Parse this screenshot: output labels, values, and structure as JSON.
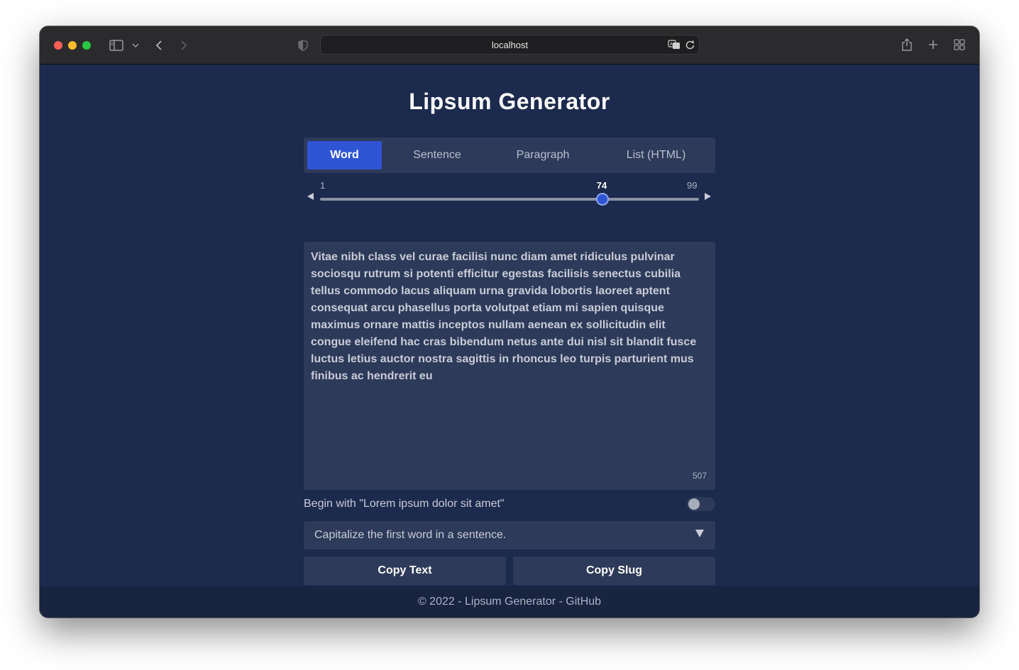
{
  "browser": {
    "url": "localhost"
  },
  "app": {
    "title": "Lipsum Generator",
    "tabs": [
      {
        "label": "Word",
        "active": true
      },
      {
        "label": "Sentence",
        "active": false
      },
      {
        "label": "Paragraph",
        "active": false
      },
      {
        "label": "List (HTML)",
        "active": false
      }
    ],
    "slider": {
      "min_label": "1",
      "max_label": "99",
      "value_label": "74",
      "min": 1,
      "max": 99,
      "value": 74
    },
    "output": {
      "text": "Vitae nibh class vel curae facilisi nunc diam amet ridiculus pulvinar sociosqu rutrum si potenti efficitur egestas facilisis senectus cubilia tellus commodo lacus aliquam urna gravida lobortis laoreet aptent consequat arcu phasellus porta volutpat etiam mi sapien quisque maximus ornare mattis inceptos nullam aenean ex sollicitudin elit congue eleifend hac cras bibendum netus ante dui nisl sit blandit fusce luctus letius auctor nostra sagittis in rhoncus leo turpis parturient mus finibus ac hendrerit eu",
      "char_count": "507"
    },
    "toggle": {
      "label": "Begin with \"Lorem ipsum dolor sit amet\"",
      "on": false
    },
    "select": {
      "value": "Capitalize the first word in a sentence."
    },
    "buttons": {
      "copy_text": "Copy Text",
      "copy_slug": "Copy Slug"
    },
    "footer": {
      "text": "© 2022 - Lipsum Generator - GitHub"
    }
  },
  "colors": {
    "background": "#1c2a4d",
    "panel": "#2e3a59",
    "accent": "#2f55d4"
  }
}
